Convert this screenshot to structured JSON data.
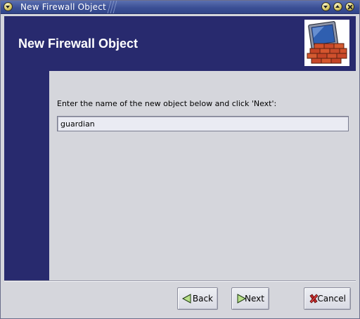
{
  "window": {
    "title": "New Firewall Object"
  },
  "titlebar_buttons": {
    "menu_icon": "chevron-down-icon",
    "minimize_icon": "chevron-down-icon",
    "maximize_icon": "chevron-up-icon",
    "close_icon": "close-icon"
  },
  "header": {
    "title": "New Firewall Object",
    "logo_icon": "firewall-brick-wall-monitor-icon"
  },
  "main": {
    "prompt": "Enter the name of the new object below and click 'Next':",
    "name_value": "guardian"
  },
  "buttons": {
    "back_label": "Back",
    "next_label": "Next",
    "cancel_label": "Cancel",
    "back_icon": "arrow-left-icon",
    "next_icon": "arrow-right-icon",
    "cancel_icon": "x-icon"
  },
  "colors": {
    "header_bg": "#282a6e",
    "titlebar_bg": "#3b4f95",
    "content_bg": "#d5d6dc",
    "arrow_green": "#b8e08a",
    "cancel_red": "#c02a2a"
  }
}
